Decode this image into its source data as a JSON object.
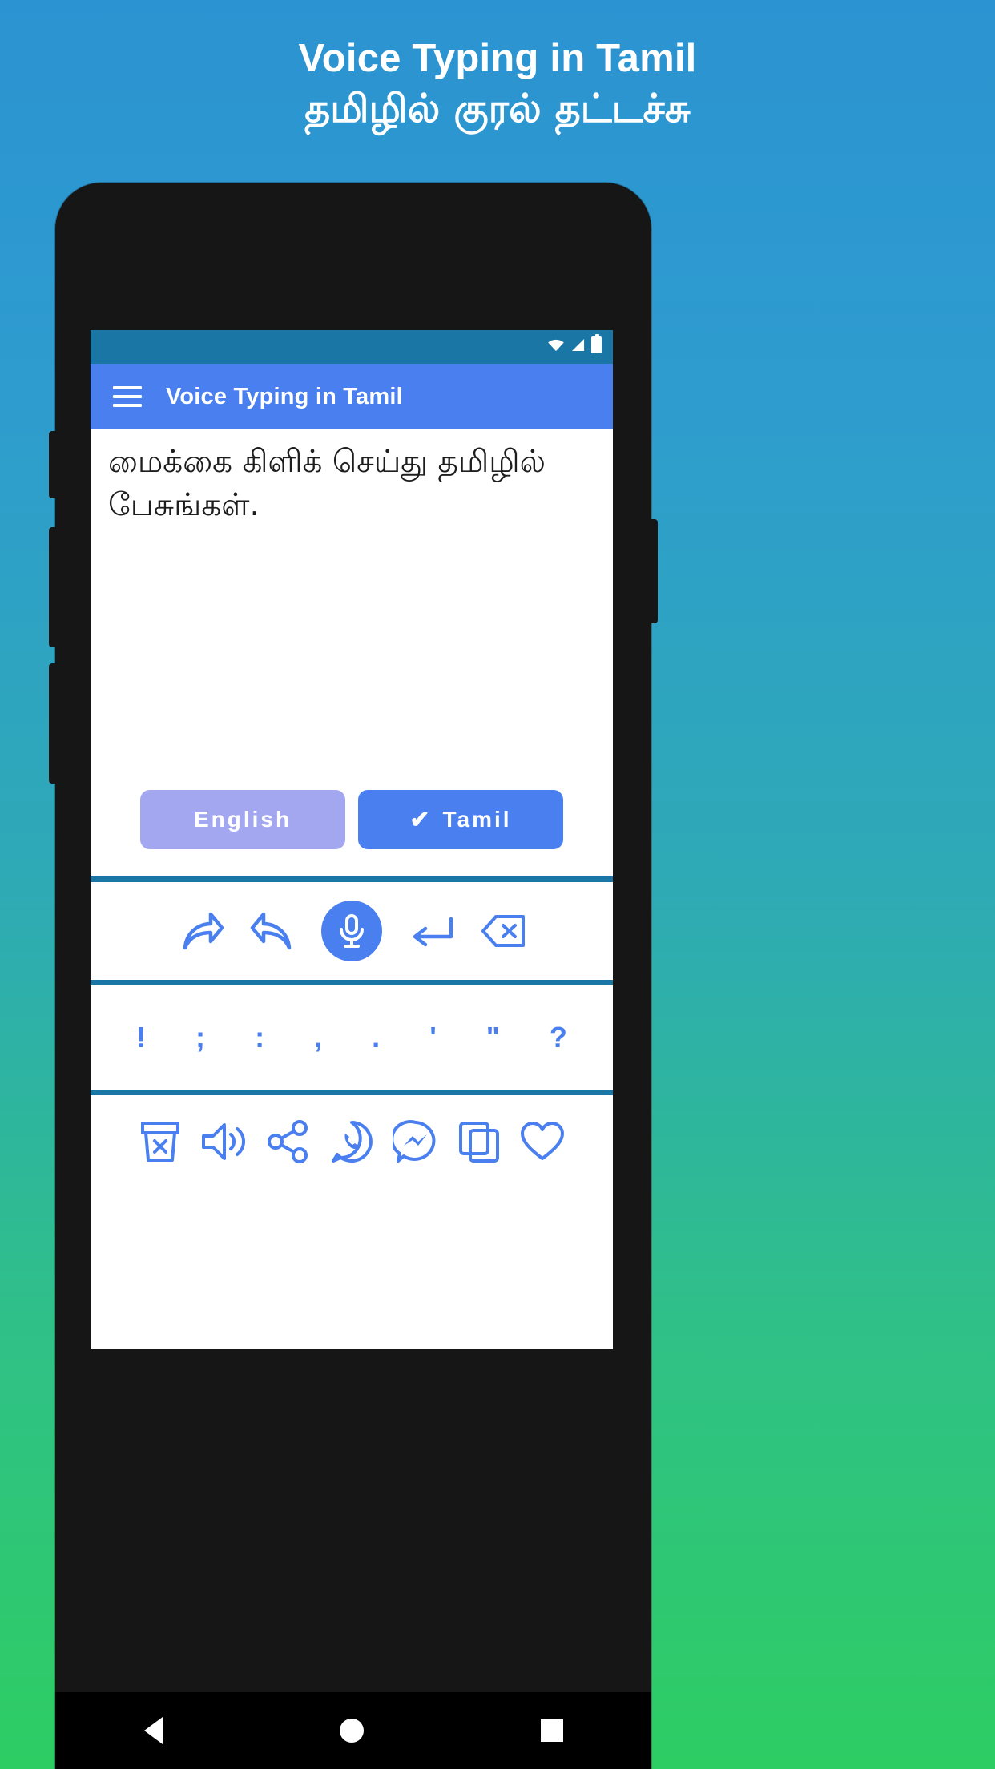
{
  "promo": {
    "title_en": "Voice Typing in Tamil",
    "title_ta": "தமிழில் குரல் தட்டச்சு"
  },
  "phone": {
    "status_bar": {
      "wifi_icon": "wifi-icon",
      "signal_icon": "signal-icon",
      "battery_icon": "battery-icon"
    },
    "app_bar": {
      "menu_icon": "hamburger-menu-icon",
      "title": "Voice Typing in Tamil"
    },
    "editor": {
      "text": "மைக்கை கிளிக் செய்து தமிழில் பேசுங்கள்."
    },
    "language_buttons": [
      {
        "label": "English",
        "selected": false,
        "check": ""
      },
      {
        "label": "Tamil",
        "selected": true,
        "check": "✔"
      }
    ],
    "edit_toolbar": [
      {
        "name": "redo-icon",
        "label": "Redo"
      },
      {
        "name": "undo-icon",
        "label": "Undo"
      },
      {
        "name": "microphone-icon",
        "label": "Microphone"
      },
      {
        "name": "enter-newline-icon",
        "label": "New line"
      },
      {
        "name": "backspace-icon",
        "label": "Backspace"
      }
    ],
    "punctuation": [
      "!",
      ";",
      ":",
      ",",
      ".",
      "'",
      "\"",
      "?"
    ],
    "action_toolbar": [
      {
        "name": "clear-trash-icon",
        "label": "Clear"
      },
      {
        "name": "speaker-icon",
        "label": "Speak"
      },
      {
        "name": "share-icon",
        "label": "Share"
      },
      {
        "name": "whatsapp-icon",
        "label": "WhatsApp"
      },
      {
        "name": "messenger-icon",
        "label": "Messenger"
      },
      {
        "name": "copy-icon",
        "label": "Copy"
      },
      {
        "name": "favorite-heart-icon",
        "label": "Favorite"
      }
    ],
    "nav_bar": {
      "back_icon": "nav-back-icon",
      "home_icon": "nav-home-icon",
      "recents_icon": "nav-recents-icon"
    }
  },
  "colors": {
    "bg_top": "#2b93d1",
    "bg_bottom": "#2ecd63",
    "accent_blue": "#4a7ff0",
    "status_bar": "#1976a5",
    "inactive_button": "#a2a7f0"
  }
}
